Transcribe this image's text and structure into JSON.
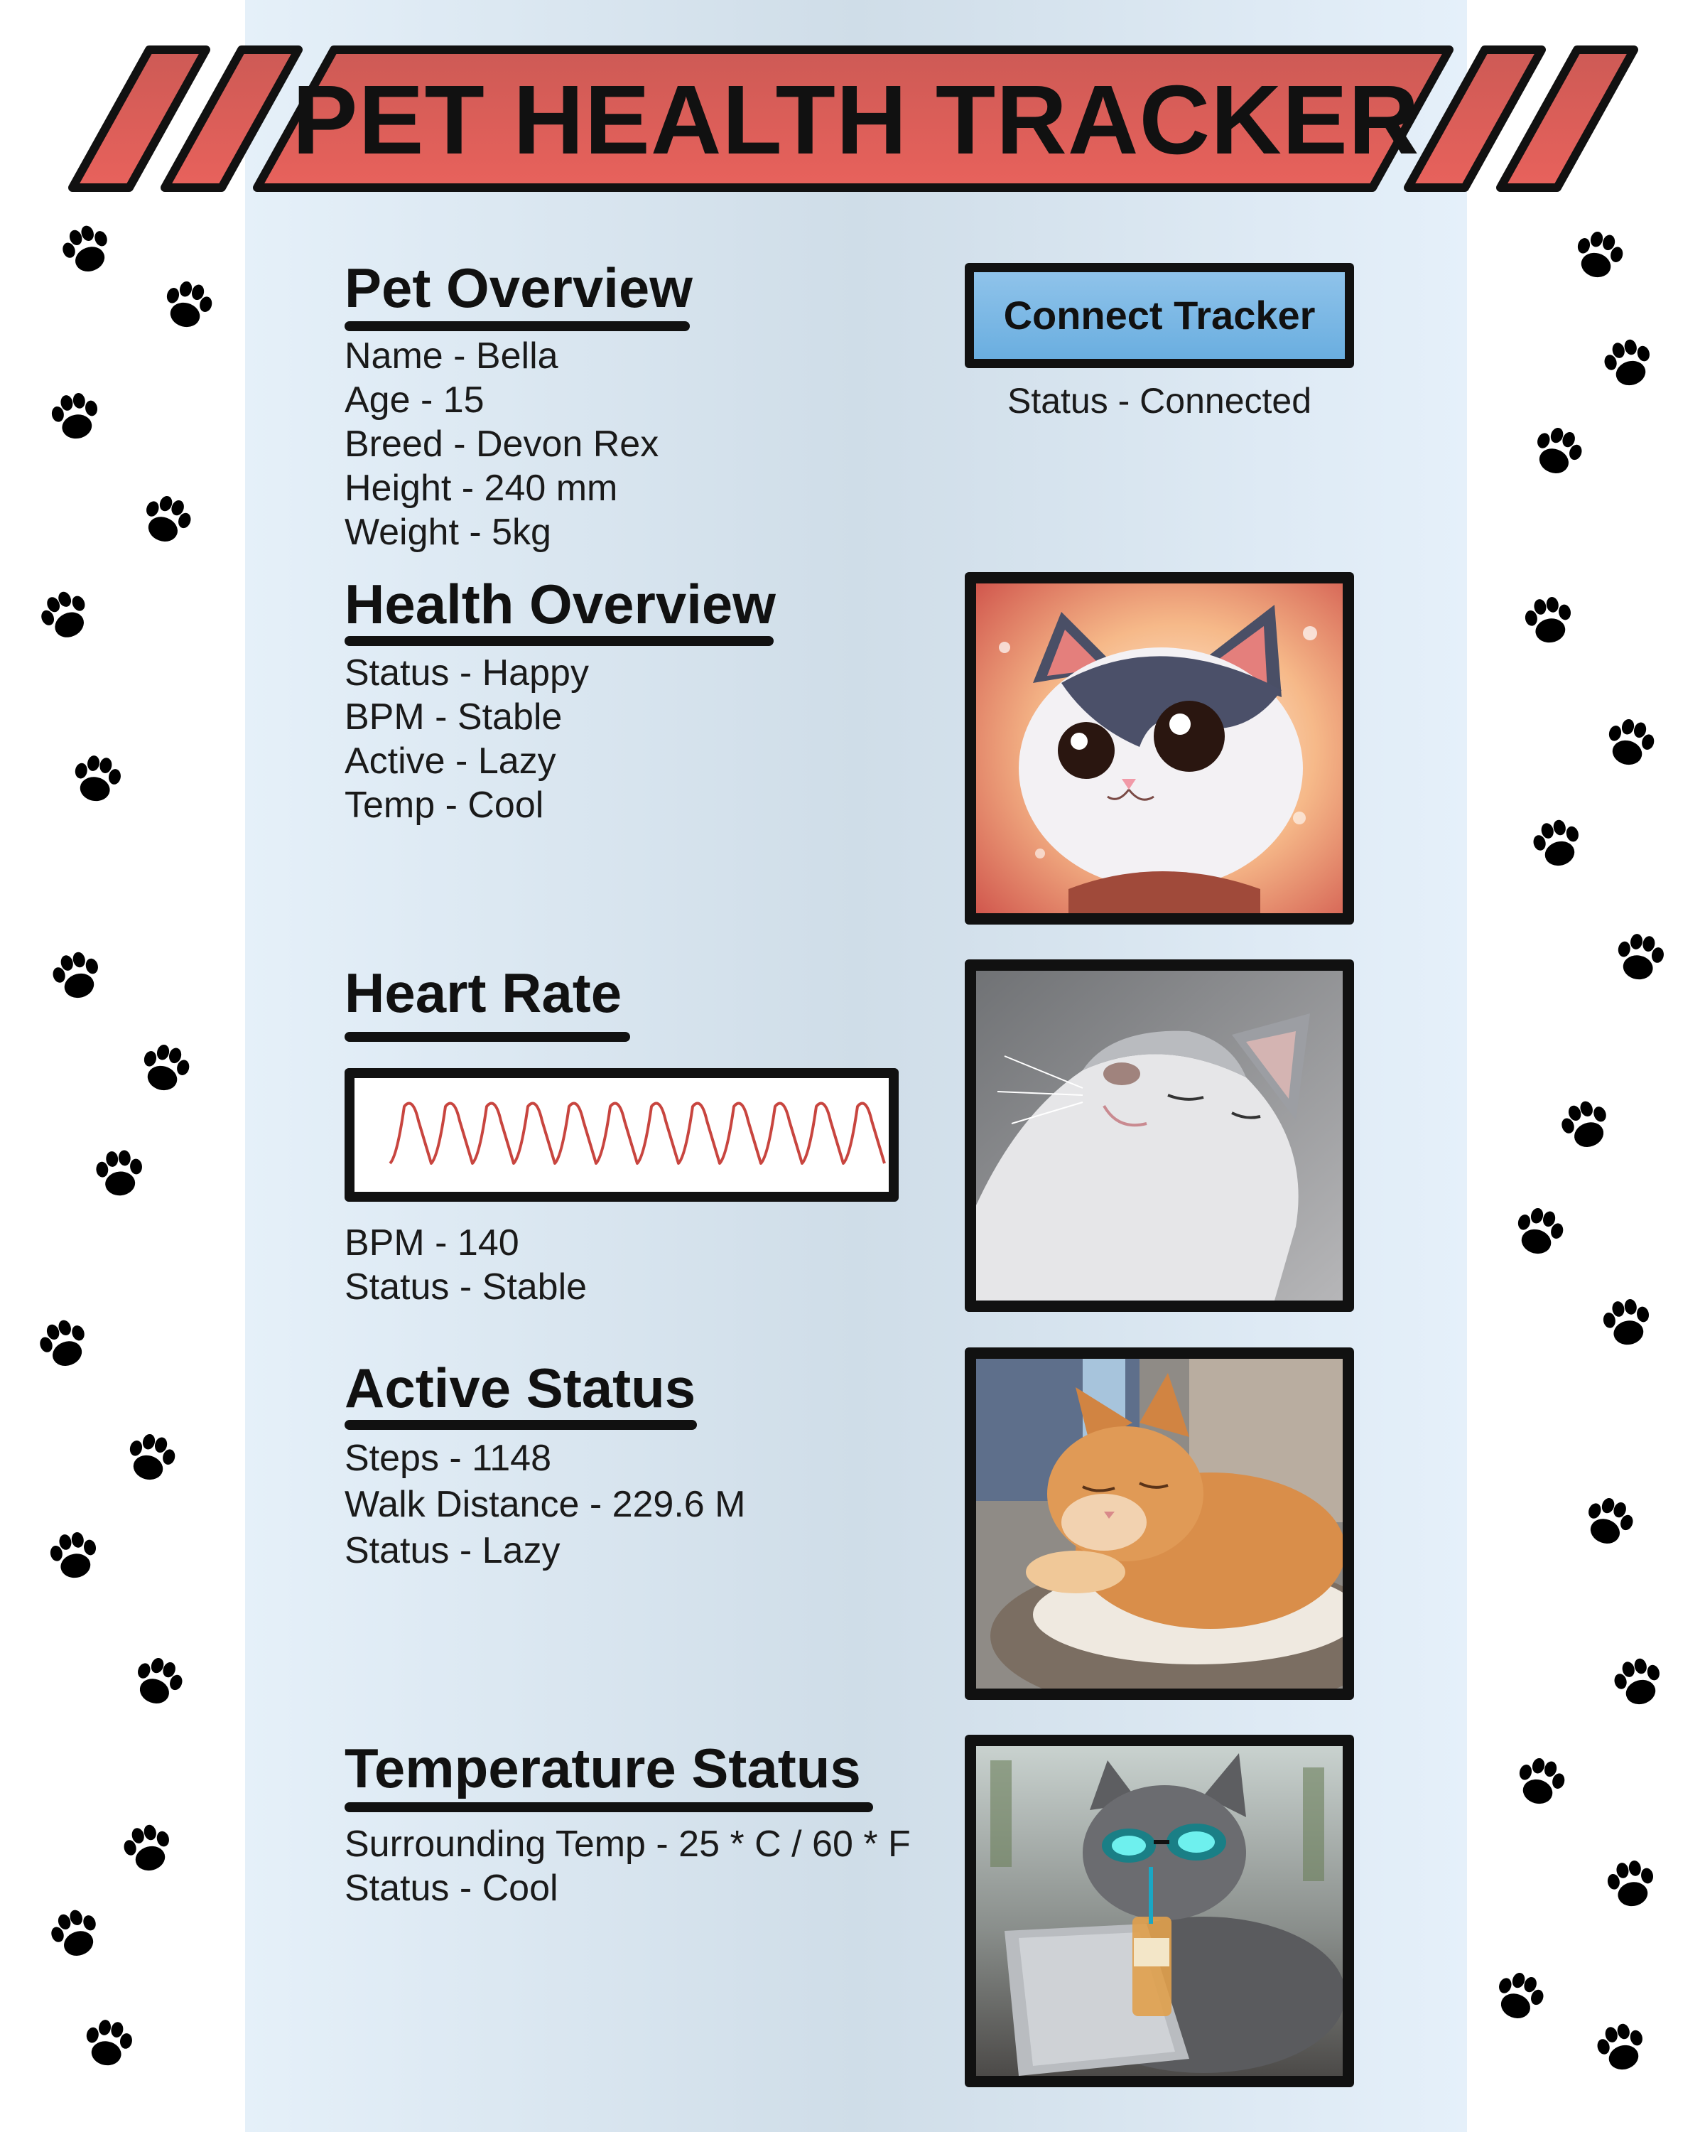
{
  "banner": {
    "title": "PET HEALTH TRACKER"
  },
  "pet_overview": {
    "heading": "Pet Overview",
    "items": [
      "Name - Bella",
      "Age - 15",
      "Breed - Devon Rex",
      "Height - 240 mm",
      "Weight - 5kg"
    ]
  },
  "tracker": {
    "button_label": "Connect Tracker",
    "status": "Status - Connected"
  },
  "health_overview": {
    "heading": "Health Overview",
    "items": [
      "Status - Happy",
      "BPM - Stable",
      "Active - Lazy",
      "Temp - Cool"
    ]
  },
  "heart_rate": {
    "heading": "Heart Rate",
    "items": [
      "BPM - 140",
      "Status - Stable"
    ]
  },
  "active_status": {
    "heading": "Active Status",
    "items": [
      "Steps - 1148",
      "Walk Distance - 229.6 M",
      "Status - Lazy"
    ]
  },
  "temperature_status": {
    "heading": "Temperature Status",
    "items": [
      "Surrounding Temp - 25 * C / 60 * F",
      "Status - Cool"
    ]
  },
  "colors": {
    "banner_red": "#e05a55",
    "button_blue": "#7bb8e6",
    "ecg_line": "#c8453f"
  },
  "icons": {
    "decoration": "paw-print-icon",
    "photos": [
      "cartoon-cat-photo",
      "gray-cat-photo",
      "sleeping-orange-cat-photo",
      "cool-cat-sunglasses-photo"
    ]
  }
}
